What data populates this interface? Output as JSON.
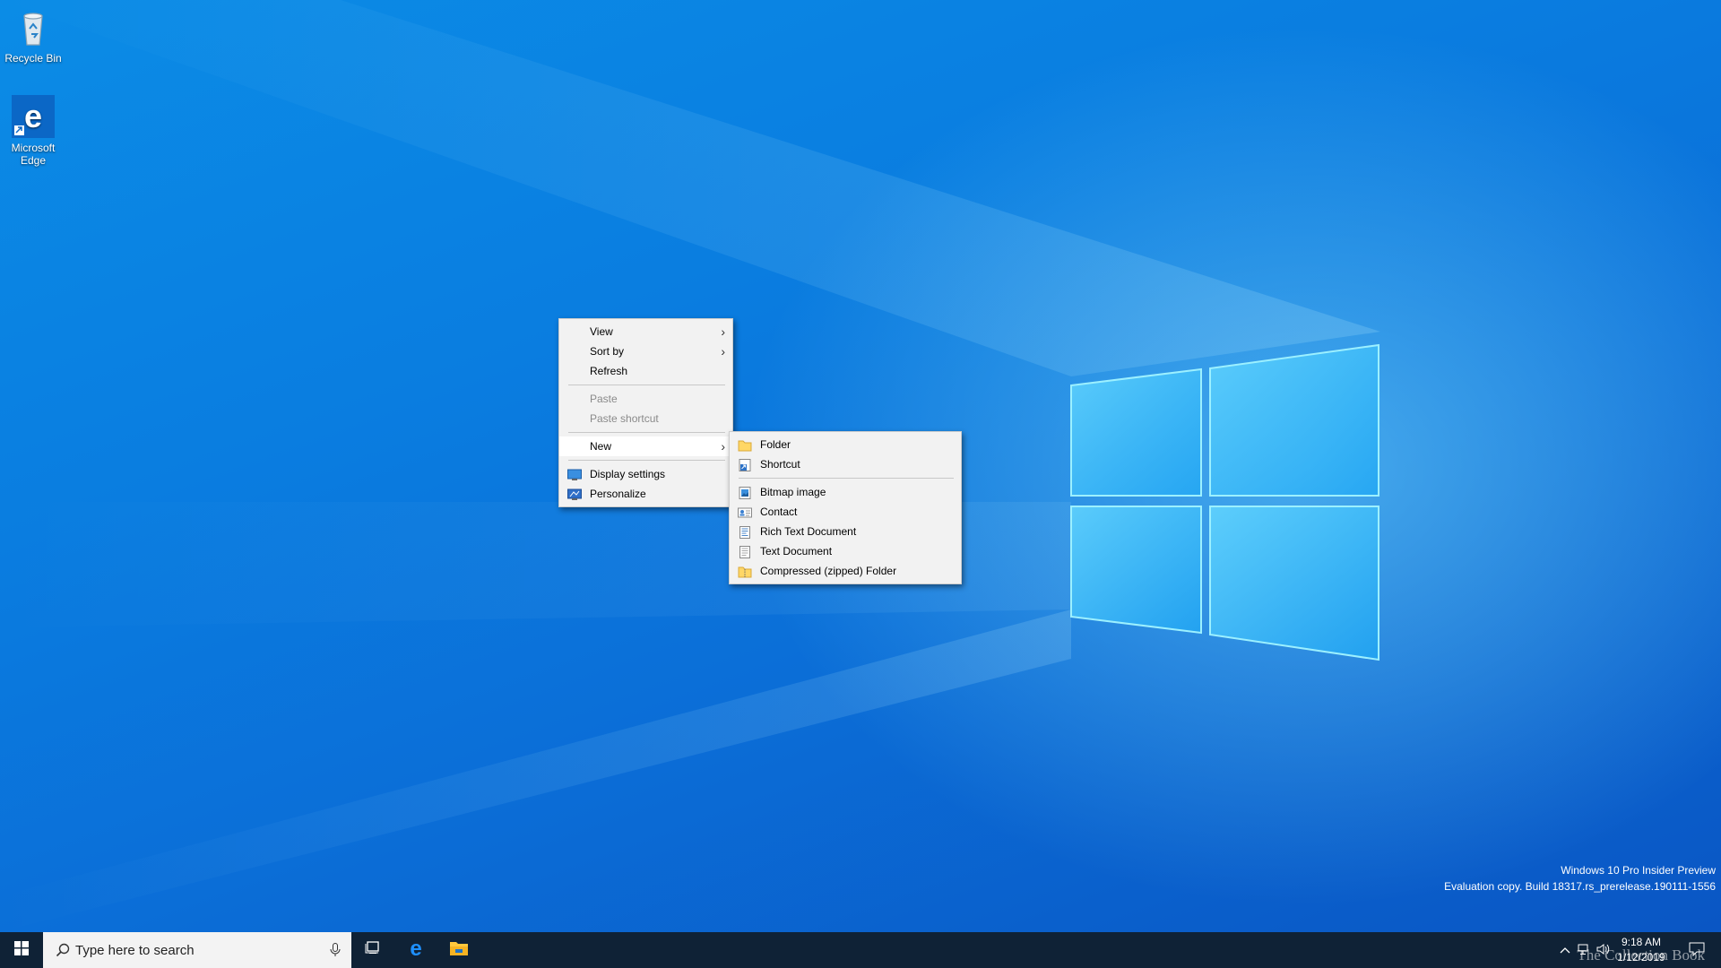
{
  "desktop": {
    "icons": [
      {
        "label": "Recycle Bin",
        "icon": "recycle-bin-icon"
      },
      {
        "label": "Microsoft Edge",
        "icon": "edge-icon"
      }
    ],
    "watermark": {
      "line1": "Windows 10 Pro Insider Preview",
      "line2": "Evaluation copy. Build 18317.rs_prerelease.190111-1556"
    }
  },
  "context_menu": {
    "items": [
      {
        "label": "View",
        "has_submenu": true,
        "enabled": true
      },
      {
        "label": "Sort by",
        "has_submenu": true,
        "enabled": true
      },
      {
        "label": "Refresh",
        "enabled": true
      },
      {
        "label": "Paste",
        "enabled": false
      },
      {
        "label": "Paste shortcut",
        "enabled": false
      },
      {
        "label": "New",
        "has_submenu": true,
        "enabled": true,
        "highlighted": true
      },
      {
        "label": "Display settings",
        "icon": "display-settings-icon",
        "enabled": true
      },
      {
        "label": "Personalize",
        "icon": "personalize-icon",
        "enabled": true
      }
    ]
  },
  "new_submenu": {
    "items": [
      {
        "label": "Folder",
        "icon": "folder-icon"
      },
      {
        "label": "Shortcut",
        "icon": "shortcut-icon"
      },
      {
        "label": "Bitmap image",
        "icon": "bitmap-image-icon"
      },
      {
        "label": "Contact",
        "icon": "contact-icon"
      },
      {
        "label": "Rich Text Document",
        "icon": "rich-text-document-icon"
      },
      {
        "label": "Text Document",
        "icon": "text-document-icon"
      },
      {
        "label": "Compressed (zipped) Folder",
        "icon": "zip-folder-icon"
      }
    ]
  },
  "taskbar": {
    "search_placeholder": "Type here to search",
    "pinned": [
      "task-view-icon",
      "edge-icon",
      "file-explorer-icon"
    ],
    "clock": {
      "time": "9:18 AM",
      "date": "1/12/2019"
    },
    "overlay_text": "The Collection Book"
  },
  "colors": {
    "desktop_blue": "#0a7de0",
    "taskbar": "#0f2236",
    "menu_background": "#f2f2f2",
    "disabled_text": "#8a8a8a"
  }
}
